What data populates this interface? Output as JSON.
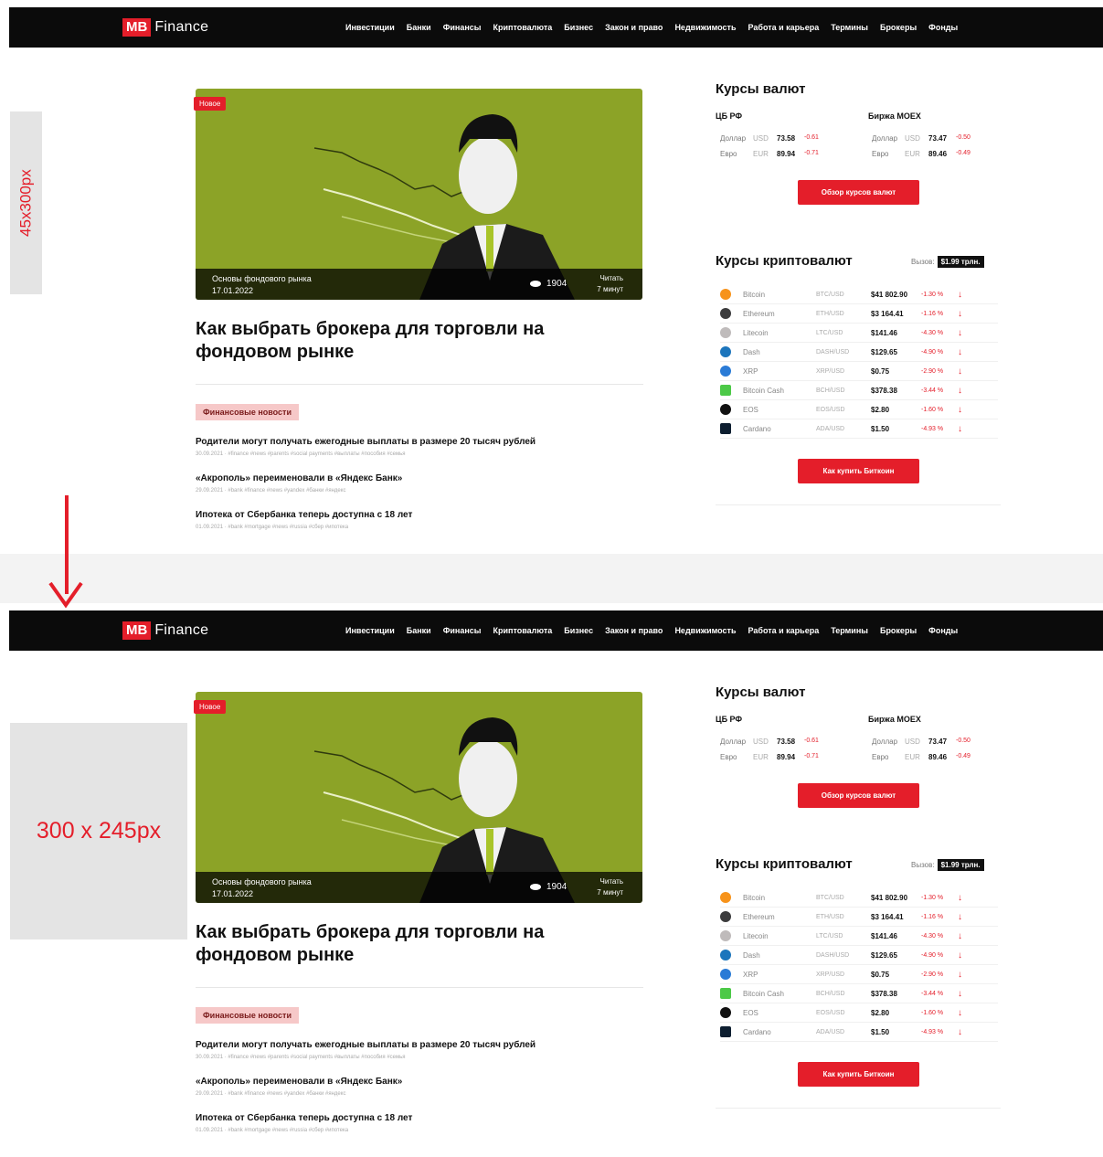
{
  "logo": {
    "mb": "MB",
    "finance": "Finance"
  },
  "nav": [
    "Инвестиции",
    "Банки",
    "Финансы",
    "Криптовалюта",
    "Бизнес",
    "Закон и право",
    "Недвижимость",
    "Работа и карьера",
    "Термины",
    "Брокеры",
    "Фонды"
  ],
  "hero": {
    "badge": "Новое",
    "topic": "Основы фондового рынка",
    "date": "17.01.2022",
    "views": "1904",
    "read_label": "Читать",
    "read_time": "7 минут",
    "color": "#8ca327"
  },
  "headline": "Как выбрать брокера для торговли на фондовом рынке",
  "category": "Финансовые новости",
  "news": [
    {
      "title": "Родители могут получать ежегодные выплаты в размере 20 тысяч рублей",
      "meta": "30.09.2021 · #finance #news #parents #social payments #выплаты #пособия #семья"
    },
    {
      "title": "«Акрополь» переименовали в «Яндекс Банк»",
      "meta": "29.09.2021 · #bank #finance #news #yandex #банки #яндекс"
    },
    {
      "title": "Ипотека от Сбербанка теперь доступна с 18 лет",
      "meta": "01.09.2021 · #bank #mortgage #news #russia #сбер #ипотека"
    }
  ],
  "fx": {
    "title": "Курсы валют",
    "cb_title": "ЦБ РФ",
    "moex_title": "Биржа MOEX",
    "cb": [
      {
        "name": "Доллар",
        "code": "USD",
        "value": "73.58",
        "delta": "-0.61"
      },
      {
        "name": "Евро",
        "code": "EUR",
        "value": "89.94",
        "delta": "-0.71"
      }
    ],
    "moex": [
      {
        "name": "Доллар",
        "code": "USD",
        "value": "73.47",
        "delta": "-0.50"
      },
      {
        "name": "Евро",
        "code": "EUR",
        "value": "89.46",
        "delta": "-0.49"
      }
    ],
    "button": "Обзор курсов валют"
  },
  "crypto": {
    "title": "Курсы криптовалют",
    "volume_label": "Вызов:",
    "volume_value": "$1.99 трлн.",
    "button": "Как купить Биткоин",
    "rows": [
      {
        "name": "Bitcoin",
        "pair": "BTC/USD",
        "price": "$41 802.90",
        "change": "-1.30 %",
        "icon": "bitcoin-icon",
        "color": "#f7931a"
      },
      {
        "name": "Ethereum",
        "pair": "ETH/USD",
        "price": "$3 164.41",
        "change": "-1.16 %",
        "icon": "ethereum-icon",
        "color": "#3c3c3d"
      },
      {
        "name": "Litecoin",
        "pair": "LTC/USD",
        "price": "$141.46",
        "change": "-4.30 %",
        "icon": "litecoin-icon",
        "color": "#bfbbbb"
      },
      {
        "name": "Dash",
        "pair": "DASH/USD",
        "price": "$129.65",
        "change": "-4.90 %",
        "icon": "dash-icon",
        "color": "#1c75bc"
      },
      {
        "name": "XRP",
        "pair": "XRP/USD",
        "price": "$0.75",
        "change": "-2.90 %",
        "icon": "xrp-icon",
        "color": "#2a7bd6"
      },
      {
        "name": "Bitcoin Cash",
        "pair": "BCH/USD",
        "price": "$378.38",
        "change": "-3.44 %",
        "icon": "bitcoin-cash-icon",
        "color": "#4cc947"
      },
      {
        "name": "EOS",
        "pair": "EOS/USD",
        "price": "$2.80",
        "change": "-1.60 %",
        "icon": "eos-icon",
        "color": "#111111"
      },
      {
        "name": "Cardano",
        "pair": "ADA/USD",
        "price": "$1.50",
        "change": "-4.93 %",
        "icon": "cardano-icon",
        "color": "#0d1e30"
      }
    ]
  },
  "placeholders": {
    "tall": "45x300px",
    "wide": "300 x 245px"
  },
  "colors": {
    "accent": "#e41e2a",
    "navbar": "#0b0b0b"
  }
}
